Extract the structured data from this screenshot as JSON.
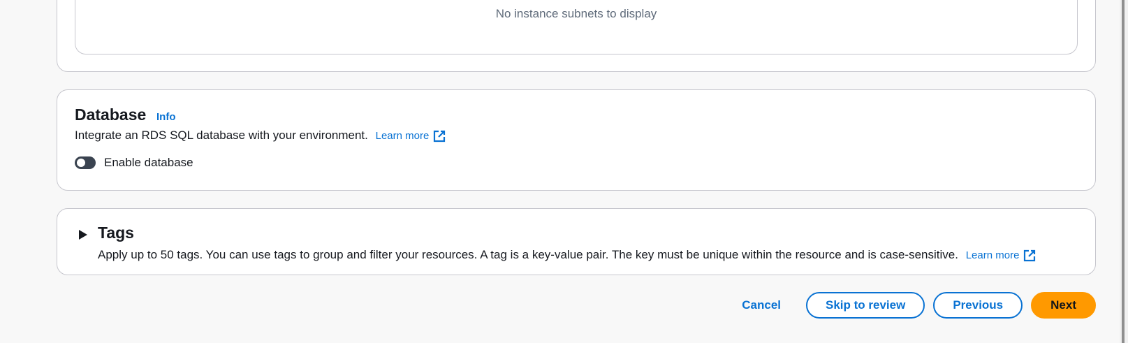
{
  "subnets": {
    "empty_message": "No instance subnets to display"
  },
  "database": {
    "title": "Database",
    "info": "Info",
    "description": "Integrate an RDS SQL database with your environment.",
    "learn_more": "Learn more",
    "toggle_label": "Enable database",
    "toggle_on": false
  },
  "tags": {
    "title": "Tags",
    "description": "Apply up to 50 tags. You can use tags to group and filter your resources. A tag is a key-value pair. The key must be unique within the resource and is case-sensitive.",
    "learn_more": "Learn more"
  },
  "actions": {
    "cancel": "Cancel",
    "skip": "Skip to review",
    "previous": "Previous",
    "next": "Next"
  },
  "colors": {
    "link": "#0972d3",
    "primary": "#ff9900"
  }
}
